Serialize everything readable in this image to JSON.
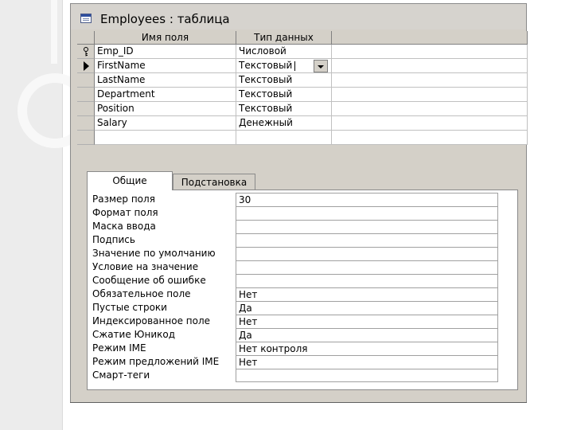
{
  "window": {
    "title": "Employees : таблица",
    "title_icon": "table-icon"
  },
  "design_grid": {
    "headers": [
      "Имя поля",
      "Тип данных",
      ""
    ],
    "rows": [
      {
        "name": "Emp_ID",
        "type": "Числовой",
        "primary_key": true,
        "current": false
      },
      {
        "name": "FirstName",
        "type": "Текстовый",
        "primary_key": false,
        "current": true
      },
      {
        "name": "LastName",
        "type": "Текстовый",
        "primary_key": false,
        "current": false
      },
      {
        "name": "Department",
        "type": "Текстовый",
        "primary_key": false,
        "current": false
      },
      {
        "name": "Position",
        "type": "Текстовый",
        "primary_key": false,
        "current": false
      },
      {
        "name": "Salary",
        "type": "Денежный",
        "primary_key": false,
        "current": false
      },
      {
        "name": "",
        "type": "",
        "primary_key": false,
        "current": false
      }
    ]
  },
  "properties": {
    "tabs": [
      "Общие",
      "Подстановка"
    ],
    "active_tab": "Общие",
    "rows": [
      {
        "label": "Размер поля",
        "value": "30"
      },
      {
        "label": "Формат поля",
        "value": ""
      },
      {
        "label": "Маска ввода",
        "value": ""
      },
      {
        "label": "Подпись",
        "value": ""
      },
      {
        "label": "Значение по умолчанию",
        "value": ""
      },
      {
        "label": "Условие на значение",
        "value": ""
      },
      {
        "label": "Сообщение об ошибке",
        "value": ""
      },
      {
        "label": "Обязательное поле",
        "value": "Нет"
      },
      {
        "label": "Пустые строки",
        "value": "Да"
      },
      {
        "label": "Индексированное поле",
        "value": "Нет"
      },
      {
        "label": "Сжатие Юникод",
        "value": "Да"
      },
      {
        "label": "Режим IME",
        "value": "Нет контроля"
      },
      {
        "label": "Режим предложений IME",
        "value": "Нет"
      },
      {
        "label": "Смарт-теги",
        "value": ""
      }
    ]
  }
}
